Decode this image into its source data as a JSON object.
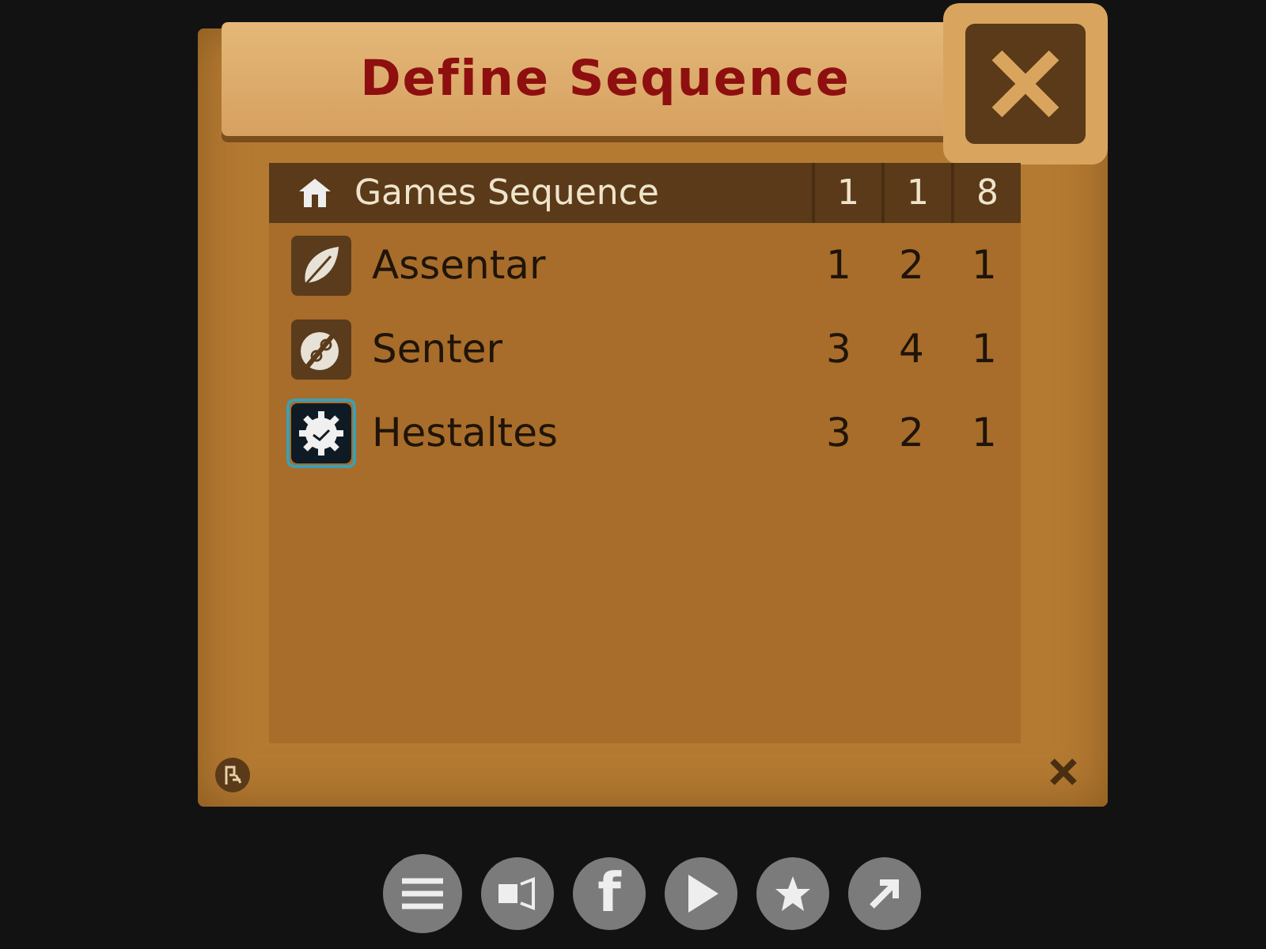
{
  "dialog": {
    "title": "Define Sequence"
  },
  "table": {
    "header": {
      "label": "Games Sequence",
      "values": [
        "1",
        "1",
        "8"
      ]
    },
    "rows": [
      {
        "name": "Assentar",
        "values": [
          "1",
          "2",
          "1"
        ],
        "selected": false
      },
      {
        "name": "Senter",
        "values": [
          "3",
          "4",
          "1"
        ],
        "selected": false
      },
      {
        "name": "Hestaltes",
        "values": [
          "3",
          "2",
          "1"
        ],
        "selected": true
      }
    ]
  },
  "toolbar": {
    "social_label": "f"
  }
}
